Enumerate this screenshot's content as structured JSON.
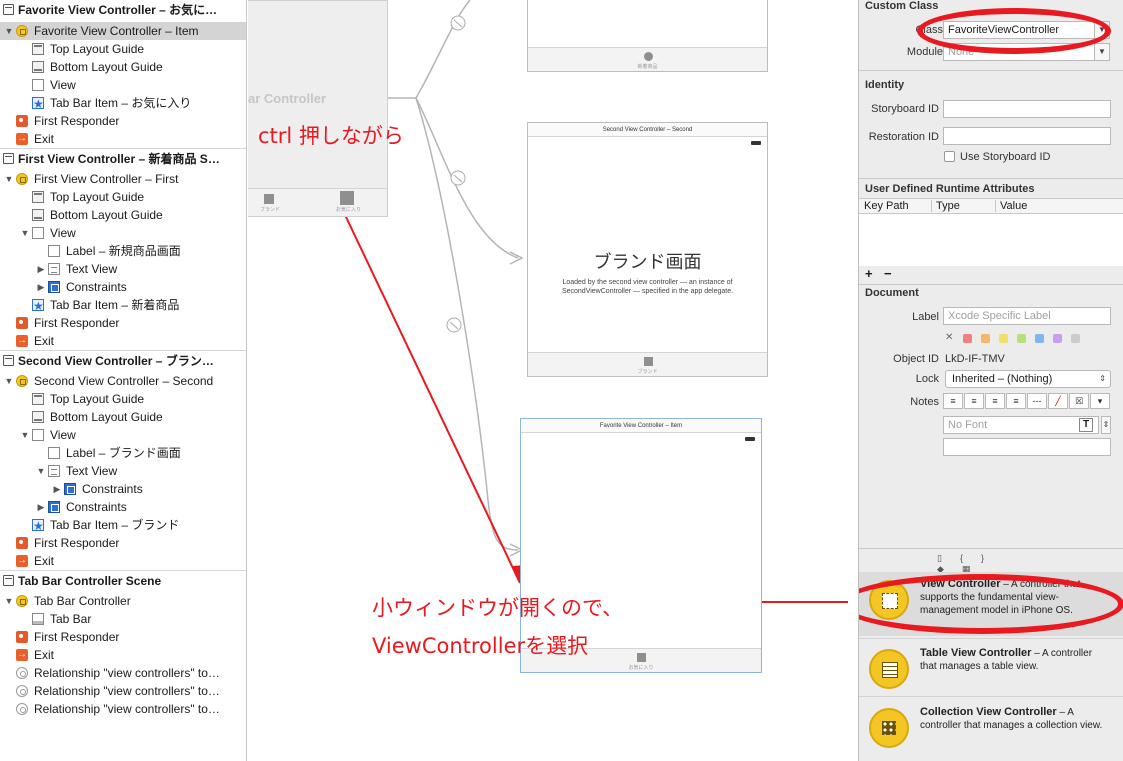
{
  "outline": {
    "scenes": [
      {
        "title": "Favorite View Controller – お気に…",
        "rows": [
          {
            "label": "Favorite View Controller – Item",
            "icon": "view-controller-icon",
            "indent": 0,
            "tri": "▼",
            "selected": true
          },
          {
            "label": "Top Layout Guide",
            "icon": "top-layout-guide-icon",
            "indent": 1
          },
          {
            "label": "Bottom Layout Guide",
            "icon": "bottom-layout-guide-icon",
            "indent": 1
          },
          {
            "label": "View",
            "icon": "view-icon",
            "indent": 1
          },
          {
            "label": "Tab Bar Item – お気に入り",
            "icon": "tab-bar-item-star-icon",
            "indent": 1
          },
          {
            "label": "First Responder",
            "icon": "first-responder-icon",
            "indent": 0
          },
          {
            "label": "Exit",
            "icon": "exit-icon",
            "indent": 0
          }
        ]
      },
      {
        "title": "First View Controller – 新着商品 S…",
        "rows": [
          {
            "label": "First View Controller – First",
            "icon": "view-controller-icon",
            "indent": 0,
            "tri": "▼"
          },
          {
            "label": "Top Layout Guide",
            "icon": "top-layout-guide-icon",
            "indent": 1
          },
          {
            "label": "Bottom Layout Guide",
            "icon": "bottom-layout-guide-icon",
            "indent": 1
          },
          {
            "label": "View",
            "icon": "view-icon",
            "indent": 1,
            "tri": "▼"
          },
          {
            "label": "Label – 新規商品画面",
            "icon": "label-icon",
            "indent": 2
          },
          {
            "label": "Text View",
            "icon": "text-view-icon",
            "indent": 2,
            "tri": "▶"
          },
          {
            "label": "Constraints",
            "icon": "constraints-icon",
            "indent": 2,
            "tri": "▶"
          },
          {
            "label": "Tab Bar Item – 新着商品",
            "icon": "tab-bar-item-star-icon",
            "indent": 1
          },
          {
            "label": "First Responder",
            "icon": "first-responder-icon",
            "indent": 0
          },
          {
            "label": "Exit",
            "icon": "exit-icon",
            "indent": 0
          }
        ]
      },
      {
        "title": "Second View Controller – ブラン…",
        "rows": [
          {
            "label": "Second View Controller – Second",
            "icon": "view-controller-icon",
            "indent": 0,
            "tri": "▼"
          },
          {
            "label": "Top Layout Guide",
            "icon": "top-layout-guide-icon",
            "indent": 1
          },
          {
            "label": "Bottom Layout Guide",
            "icon": "bottom-layout-guide-icon",
            "indent": 1
          },
          {
            "label": "View",
            "icon": "view-icon",
            "indent": 1,
            "tri": "▼"
          },
          {
            "label": "Label – ブランド画面",
            "icon": "label-icon",
            "indent": 2
          },
          {
            "label": "Text View",
            "icon": "text-view-icon",
            "indent": 2,
            "tri": "▼"
          },
          {
            "label": "Constraints",
            "icon": "constraints-icon",
            "indent": 3,
            "tri": "▶"
          },
          {
            "label": "Constraints",
            "icon": "constraints-icon",
            "indent": 2,
            "tri": "▶"
          },
          {
            "label": "Tab Bar Item – ブランド",
            "icon": "tab-bar-item-star-icon",
            "indent": 1
          },
          {
            "label": "First Responder",
            "icon": "first-responder-icon",
            "indent": 0
          },
          {
            "label": "Exit",
            "icon": "exit-icon",
            "indent": 0
          }
        ]
      },
      {
        "title": "Tab Bar Controller Scene",
        "rows": [
          {
            "label": "Tab Bar Controller",
            "icon": "view-controller-icon",
            "indent": 0,
            "tri": "▼"
          },
          {
            "label": "Tab Bar",
            "icon": "tab-bar-icon",
            "indent": 1
          },
          {
            "label": "First Responder",
            "icon": "first-responder-icon",
            "indent": 0
          },
          {
            "label": "Exit",
            "icon": "exit-icon",
            "indent": 0
          },
          {
            "label": "Relationship \"view controllers\" to…",
            "icon": "relationship-icon",
            "indent": 0
          },
          {
            "label": "Relationship \"view controllers\" to…",
            "icon": "relationship-icon",
            "indent": 0
          },
          {
            "label": "Relationship \"view controllers\" to…",
            "icon": "relationship-icon",
            "indent": 0
          }
        ]
      }
    ]
  },
  "canvas": {
    "tab_bar_controller": {
      "title": "ar Controller",
      "tab1": "ブランド",
      "tab2": "お気に入り"
    },
    "first_scene": {
      "tab_label": "新着商品"
    },
    "second_scene": {
      "title": "Second View Controller – Second",
      "heading": "ブランド画面",
      "body": "Loaded by the second view controller — an instance of SecondViewController — specified in the app delegate.",
      "tab_label": "ブランド"
    },
    "favorite_scene": {
      "title": "Favorite View Controller – Item",
      "tab_label": "お気に入り"
    },
    "annotations": {
      "ctrl": "ctrl 押しながら",
      "popup_line1": "小ウィンドウが開くので、",
      "popup_line2": "ViewControllerを選択"
    },
    "annotation_color": "#e8191f"
  },
  "inspector": {
    "custom_class": {
      "title": "Custom Class",
      "class_label": "Class",
      "class_value": "FavoriteViewController",
      "module_label": "Module",
      "module_placeholder": "None"
    },
    "identity": {
      "title": "Identity",
      "storyboard_id_label": "Storyboard ID",
      "restoration_id_label": "Restoration ID",
      "use_storyboard_id_label": "Use Storyboard ID"
    },
    "runtime_attributes": {
      "title": "User Defined Runtime Attributes",
      "columns": [
        "Key Path",
        "Type",
        "Value"
      ],
      "add": "+",
      "remove": "−"
    },
    "document": {
      "title": "Document",
      "label_label": "Label",
      "label_placeholder": "Xcode Specific Label",
      "clear_mark": "✕",
      "swatch_colors": [
        "#f07f7f",
        "#f5b66b",
        "#f2df6a",
        "#b7e07a",
        "#7fb7f0",
        "#c89ff0",
        "#cccccc"
      ],
      "object_id_label": "Object ID",
      "object_id_value": "LkD-IF-TMV",
      "lock_label": "Lock",
      "lock_value": "Inherited – (Nothing)",
      "notes_label": "Notes",
      "font_placeholder": "No Font"
    },
    "library": {
      "items": [
        {
          "name": "View Controller",
          "desc": " – A controller that supports the fundamental view-management model in iPhone OS."
        },
        {
          "name": "Table View Controller",
          "desc": " – A controller that manages a table view."
        },
        {
          "name": "Collection View Controller",
          "desc": " – A controller that manages a collection view."
        }
      ]
    }
  }
}
